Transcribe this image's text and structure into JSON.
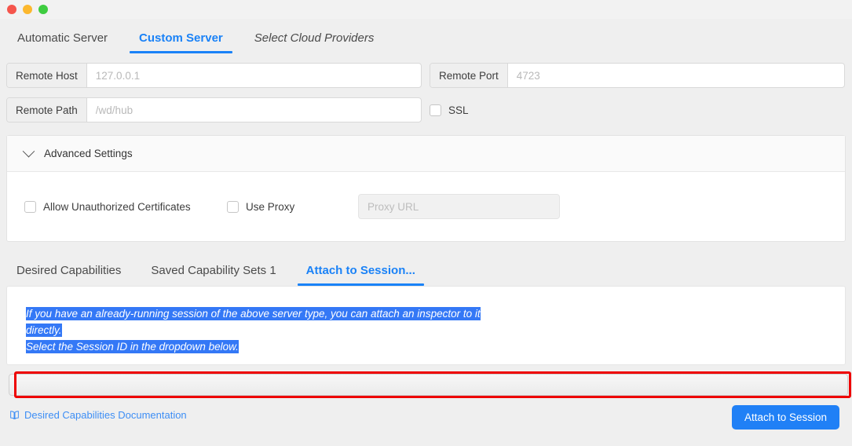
{
  "window": {
    "controls": [
      {
        "name": "close",
        "color": "#f5554c"
      },
      {
        "name": "minimize",
        "color": "#fcb82e"
      },
      {
        "name": "zoom",
        "color": "#3ecc40"
      }
    ]
  },
  "server_tabs": [
    {
      "label": "Automatic Server",
      "active": false,
      "italic": false
    },
    {
      "label": "Custom Server",
      "active": true,
      "italic": false
    },
    {
      "label": "Select Cloud Providers",
      "active": false,
      "italic": true
    }
  ],
  "form": {
    "remote_host": {
      "label": "Remote Host",
      "value": "",
      "placeholder": "127.0.0.1"
    },
    "remote_port": {
      "label": "Remote Port",
      "value": "",
      "placeholder": "4723"
    },
    "remote_path": {
      "label": "Remote Path",
      "value": "",
      "placeholder": "/wd/hub"
    },
    "ssl": {
      "label": "SSL",
      "checked": false
    }
  },
  "advanced": {
    "title": "Advanced Settings",
    "expanded": true,
    "allow_unauthorized": {
      "label": "Allow Unauthorized Certificates",
      "checked": false
    },
    "use_proxy": {
      "label": "Use Proxy",
      "checked": false
    },
    "proxy_url": {
      "value": "",
      "placeholder": "Proxy URL",
      "disabled": true
    }
  },
  "capability_tabs": [
    {
      "label": "Desired Capabilities",
      "active": false
    },
    {
      "label": "Saved Capability Sets 1",
      "active": false
    },
    {
      "label": "Attach to Session...",
      "active": true
    }
  ],
  "session_panel": {
    "note_line_1": "If you have an already-running session of the above server type, you can attach an inspector to it directly.",
    "note_line_2": "Select the Session ID in the dropdown below.",
    "note_selected": true,
    "highlight_color": "#3478f6"
  },
  "session_select": {
    "value": "",
    "options": [
      ""
    ],
    "annotation_color": "#ee0000"
  },
  "footer": {
    "doc_link": {
      "label": "Desired Capabilities Documentation",
      "icon": "book-icon",
      "color": "#3d8ef5"
    },
    "attach_button": {
      "label": "Attach to Session",
      "color": "#2080f6"
    }
  },
  "theme": {
    "accent": "#1a82f7",
    "background": "#efefef",
    "panel": "#ffffff",
    "text": "#3d3d3d",
    "placeholder": "#b9b9b9"
  }
}
